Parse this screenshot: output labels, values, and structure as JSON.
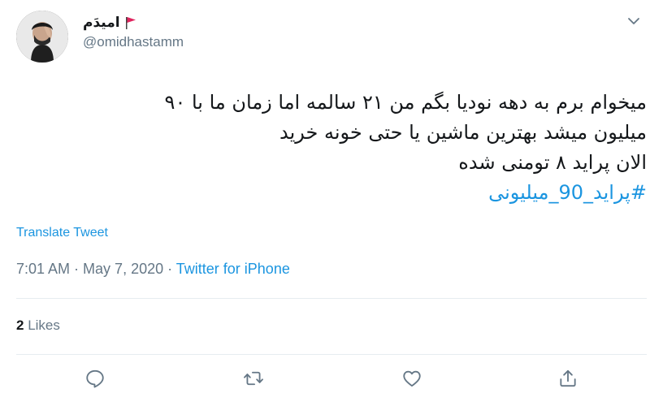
{
  "author": {
    "display_name": "امیدَم",
    "handle": "@omidhastamm",
    "flag_color": "#e0245e"
  },
  "tweet": {
    "lines": [
      "میخوام برم به دهه نودیا بگم من ۲۱ سالمه اما زمان ما با ۹۰",
      "میلیون میشد بهترین ماشین یا حتی خونه خرید",
      "الان پراید ۸ تومنی شده"
    ],
    "hashtag": "#پراید_90_میلیونی"
  },
  "translate_label": "Translate Tweet",
  "meta": {
    "time": "7:01 AM",
    "separator1": " · ",
    "date": "May 7, 2020",
    "separator2": " · ",
    "source": "Twitter for iPhone"
  },
  "stats": {
    "likes_count": "2",
    "likes_label": " Likes"
  },
  "actions": {
    "icons": [
      "reply-icon",
      "retweet-icon",
      "like-icon",
      "share-icon"
    ]
  },
  "colors": {
    "accent": "#1b95e0",
    "secondary_text": "#657786",
    "icon": "#657786",
    "divider": "#e6ecf0"
  }
}
